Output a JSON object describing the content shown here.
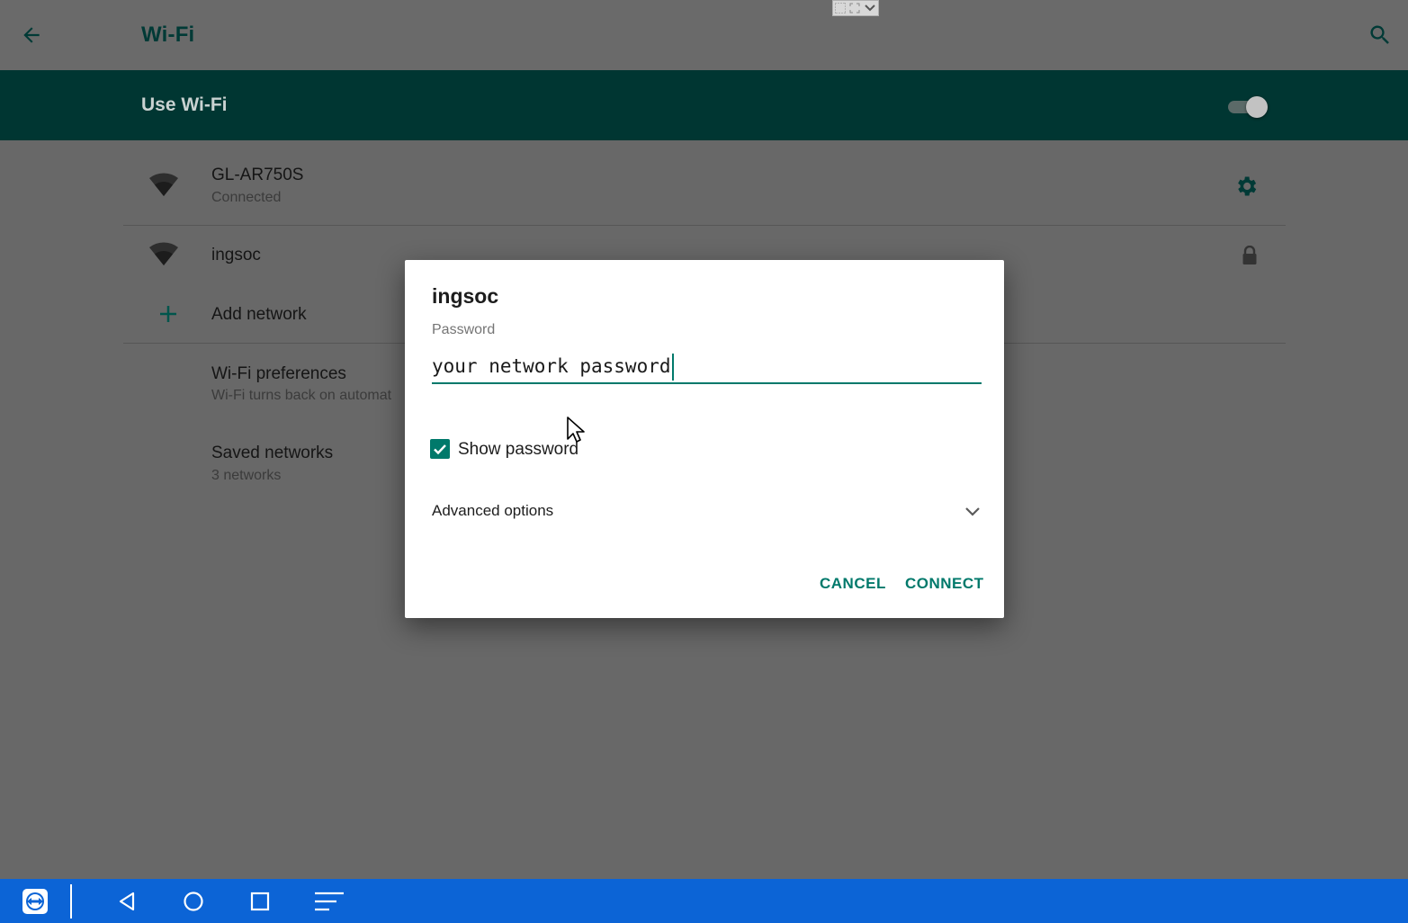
{
  "header": {
    "title": "Wi-Fi",
    "back_icon": "arrow-left-icon",
    "search_icon": "search-icon"
  },
  "master_switch": {
    "label": "Use Wi-Fi",
    "on": true
  },
  "networks": [
    {
      "name": "GL-AR750S",
      "status": "Connected",
      "icon": "wifi-signal-icon",
      "action_icon": "gear-icon"
    },
    {
      "name": "ingsoc",
      "icon": "wifi-signal-icon",
      "action_icon": "lock-icon"
    }
  ],
  "add_network": {
    "label": "Add network",
    "icon": "plus-icon"
  },
  "preferences": {
    "title": "Wi-Fi preferences",
    "subtitle": "Wi-Fi turns back on automat"
  },
  "saved": {
    "title": "Saved networks",
    "subtitle": "3 networks"
  },
  "dialog": {
    "title": "ingsoc",
    "password_label": "Password",
    "password_value": "your network password",
    "show_password_label": "Show password",
    "show_password_checked": true,
    "advanced_label": "Advanced options",
    "cancel_label": "CANCEL",
    "connect_label": "CONNECT"
  },
  "navbar": {
    "items": [
      "teamviewer-icon",
      "back-triangle-icon",
      "home-circle-icon",
      "recents-square-icon",
      "menu-lines-icon"
    ]
  },
  "colors": {
    "accent": "#00796b",
    "master_bar": "#003632",
    "navbar": "#0c64d6",
    "scrim_bg": "#686868"
  }
}
